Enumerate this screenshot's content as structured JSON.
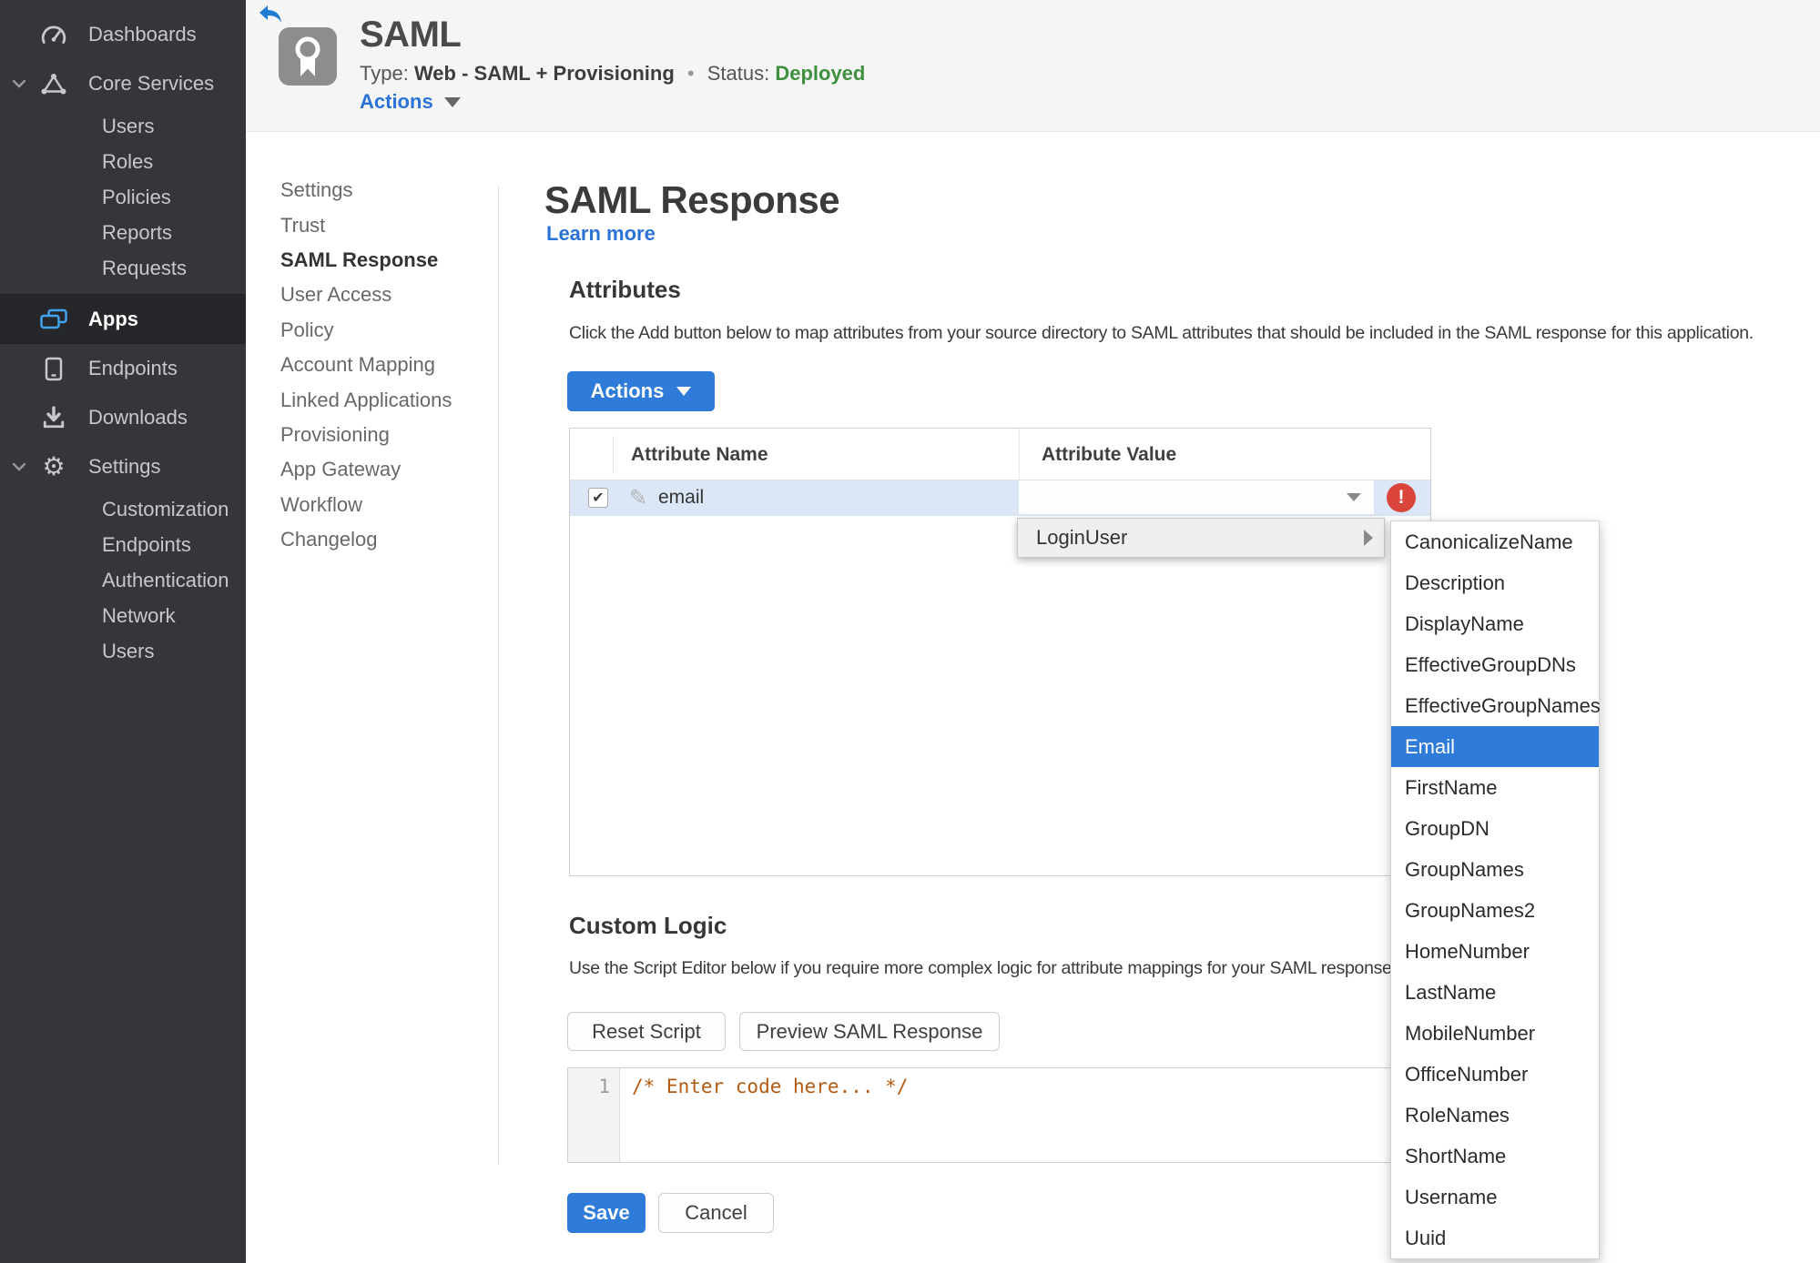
{
  "colors": {
    "accent_blue": "#2b72d7",
    "button_blue": "#2f7bd9",
    "status_green": "#3e8f3e",
    "error_red": "#d9453a",
    "selected_row_blue": "#dbe7f7",
    "sidebar_bg": "#35363a",
    "code_comment_orange": "#b35a12"
  },
  "icons": {
    "back": "back-arrow",
    "app_badge": "award-ribbon",
    "dashboards": "gauge",
    "core_services": "triangle-nodes",
    "apps": "stacked-windows",
    "endpoints": "tablet-device",
    "downloads": "download-tray",
    "settings_glyph": "⚙",
    "chevron": "chevron-down",
    "pencil_glyph": "✎",
    "check_glyph": "✔",
    "error_glyph": "!"
  },
  "sidebar": {
    "dashboards": "Dashboards",
    "core_services": "Core Services",
    "core_children": [
      "Users",
      "Roles",
      "Policies",
      "Reports",
      "Requests"
    ],
    "apps": "Apps",
    "endpoints": "Endpoints",
    "downloads": "Downloads",
    "settings": "Settings",
    "settings_children": [
      "Customization",
      "Endpoints",
      "Authentication",
      "Network",
      "Users"
    ]
  },
  "header": {
    "title": "SAML",
    "type_label": "Type:",
    "type_value": "Web - SAML + Provisioning",
    "separator": "•",
    "status_label": "Status:",
    "status_value": "Deployed",
    "actions_label": "Actions"
  },
  "subnav": {
    "items": [
      "Settings",
      "Trust",
      "SAML Response",
      "User Access",
      "Policy",
      "Account Mapping",
      "Linked Applications",
      "Provisioning",
      "App Gateway",
      "Workflow",
      "Changelog"
    ],
    "active": "SAML Response"
  },
  "main": {
    "page_title": "SAML Response",
    "learn_more": "Learn more",
    "attributes": {
      "heading": "Attributes",
      "description": "Click the Add button below to map attributes from your source directory to SAML attributes that should be included in the SAML response for this application.",
      "actions_button": "Actions",
      "columns": [
        "Attribute Name",
        "Attribute Value"
      ],
      "row": {
        "name": "email",
        "checked": true,
        "value": "",
        "error": true
      }
    },
    "value_menu": {
      "parent": "LoginUser",
      "options": [
        "CanonicalizeName",
        "Description",
        "DisplayName",
        "EffectiveGroupDNs",
        "EffectiveGroupNames",
        "Email",
        "FirstName",
        "GroupDN",
        "GroupNames",
        "GroupNames2",
        "HomeNumber",
        "LastName",
        "MobileNumber",
        "OfficeNumber",
        "RoleNames",
        "ShortName",
        "Username",
        "Uuid"
      ],
      "selected": "Email"
    },
    "custom_logic": {
      "heading": "Custom Logic",
      "description": "Use the Script Editor below if you require more complex logic for attribute mappings for your SAML response.",
      "reset_button": "Reset Script",
      "preview_button": "Preview SAML Response",
      "line_number": "1",
      "code": "/* Enter code here... */"
    },
    "save_button": "Save",
    "cancel_button": "Cancel"
  }
}
